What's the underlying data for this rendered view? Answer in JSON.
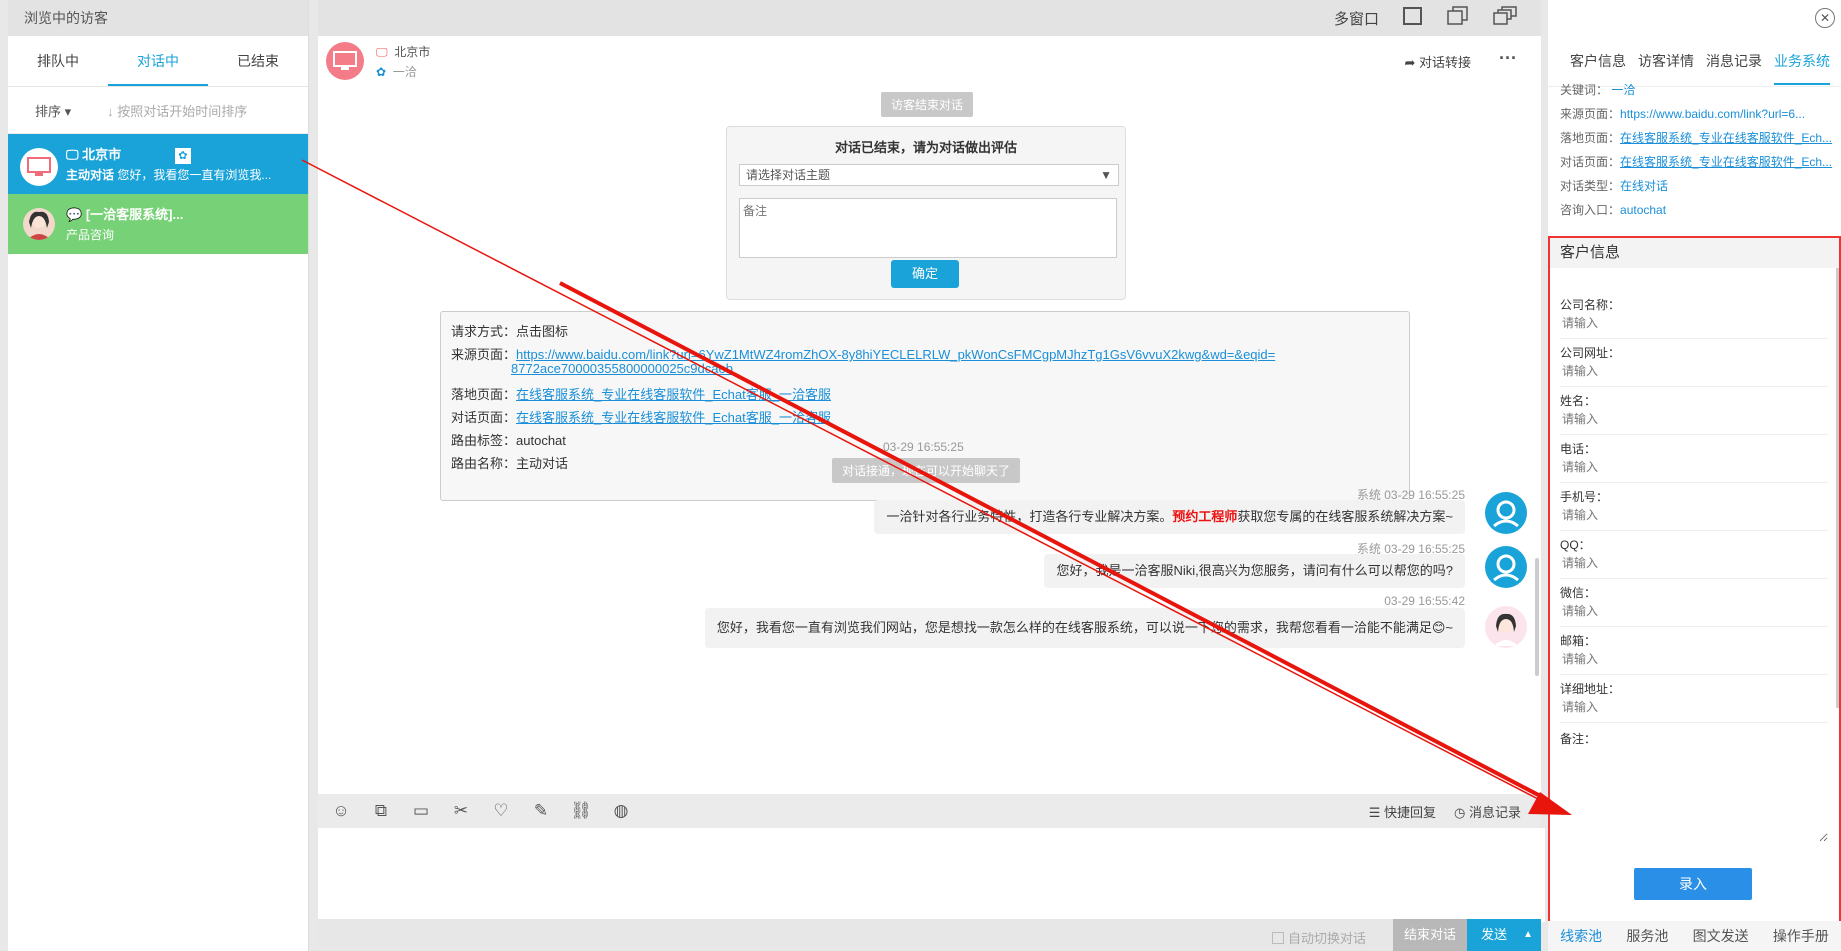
{
  "left": {
    "title": "浏览中的访客",
    "tabs": [
      "排队中",
      "对话中",
      "已结束"
    ],
    "sort_label": "排序",
    "sort_hint": "按照对话开始时间排序",
    "visitors": [
      {
        "name": "北京市",
        "type": "主动对话",
        "preview": "您好，我看您一直有浏览我..."
      },
      {
        "name": "[一洽客服系统]...",
        "preview": "产品咨询"
      }
    ]
  },
  "window": {
    "multiwin_label": "多窗口"
  },
  "chat_header": {
    "location": "北京市",
    "channel": "一洽",
    "transfer_label": "对话转接"
  },
  "messages": {
    "ended_pill": "访客结束对话",
    "eval": {
      "title": "对话已结束，请为对话做出评估",
      "topic_placeholder": "请选择对话主题",
      "note_placeholder": "备注",
      "confirm": "确定"
    },
    "info": [
      {
        "label": "请求方式：",
        "value": "点击图标",
        "link": false
      },
      {
        "label": "来源页面：",
        "value": "https://www.baidu.com/link?url=6YwZ1MtWZ4romZhOX-8y8hiYECLELRLW_pkWonCsFMCgpMJhzTg1GsV6vvuX2kwg&wd=&eqid=",
        "value2": "8772ace70000355800000025c9dcaeb",
        "link": true
      },
      {
        "label": "落地页面：",
        "value": "在线客服系统_专业在线客服软件_Echat客服_一洽客服",
        "link": true
      },
      {
        "label": "对话页面：",
        "value": "在线客服系统_专业在线客服软件_Echat客服_一洽客服",
        "link": true
      },
      {
        "label": "路由标签：",
        "value": "autochat",
        "link": false
      },
      {
        "label": "路由名称：",
        "value": "主动对话",
        "link": false
      }
    ],
    "time1": "03-29 16:55:25",
    "connected_pill": "对话接通，现在可以开始聊天了",
    "list": [
      {
        "sender": "系统",
        "time": "03-29 16:55:25",
        "text_a": "一洽针对各行业务特性，打造各行专业解决方案。",
        "text_highlight": "预约工程师",
        "text_b": "获取您专属的在线客服系统解决方案~"
      },
      {
        "sender": "系统",
        "time": "03-29 16:55:25",
        "text": "您好，我是一洽客服Niki,很高兴为您服务，请问有什么可以帮您的吗?"
      },
      {
        "sender": "",
        "time": "03-29 16:55:42",
        "text": "您好，我看您一直有浏览我们网站，您是想找一款怎么样的在线客服系统，可以说一下您的需求，我帮您看看一洽能不能满足😊~"
      }
    ]
  },
  "toolbar": {
    "quick_reply": "快捷回复",
    "history": "消息记录"
  },
  "bottom": {
    "auto_switch": "自动切换对话",
    "end_chat": "结束对话",
    "send": "发送"
  },
  "right": {
    "tabs": [
      "客户信息",
      "访客详情",
      "消息记录",
      "业务系统"
    ],
    "info": [
      {
        "label": "关键词：",
        "value": "一洽"
      },
      {
        "label": "来源页面：",
        "value": "https://www.baidu.com/link?url=6..."
      },
      {
        "label": "落地页面：",
        "value": "在线客服系统_专业在线客服软件_Ech..."
      },
      {
        "label": "对话页面：",
        "value": "在线客服系统_专业在线客服软件_Ech..."
      },
      {
        "label": "对话类型：",
        "value": "在线对话"
      },
      {
        "label": "咨询入口：",
        "value": "autochat"
      }
    ],
    "customer_title": "客户信息",
    "fields": [
      {
        "label": "公司名称：",
        "placeholder": "请输入"
      },
      {
        "label": "公司网址：",
        "placeholder": "请输入"
      },
      {
        "label": "姓名：",
        "placeholder": "请输入"
      },
      {
        "label": "电话：",
        "placeholder": "请输入"
      },
      {
        "label": "手机号：",
        "placeholder": "请输入"
      },
      {
        "label": "QQ：",
        "placeholder": "请输入"
      },
      {
        "label": "微信：",
        "placeholder": "请输入"
      },
      {
        "label": "邮箱：",
        "placeholder": "请输入"
      },
      {
        "label": "详细地址：",
        "placeholder": "请输入"
      }
    ],
    "note_label": "备注：",
    "submit": "录入",
    "bottom_links": [
      "线索池",
      "服务池",
      "图文发送",
      "操作手册"
    ]
  },
  "colors": {
    "accent": "#1aa3d8",
    "green": "#77d277",
    "arrow": "#e8150d"
  }
}
